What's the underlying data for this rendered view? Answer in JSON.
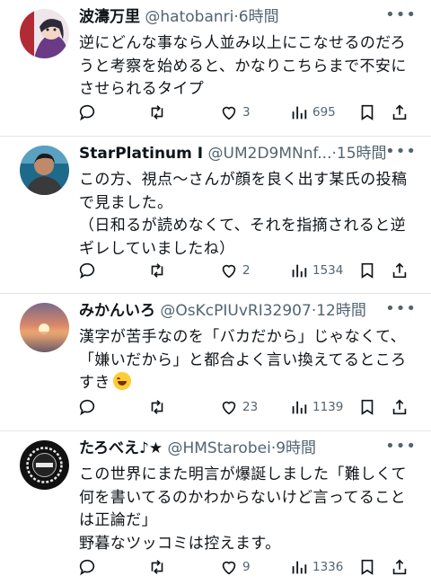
{
  "posts": [
    {
      "name": "波濤万里",
      "handle": "@hatobanri",
      "time": "·6時間",
      "lines": [
        "逆にどんな事なら人並み以上にこなせるのだろ",
        "うと考察を始めると、かなりこちらまで不安に",
        "させられるタイプ"
      ],
      "likes": "3",
      "views": "695"
    },
    {
      "name": "StarPlatinum I",
      "handle": "@UM2D9MNnf...",
      "time": "·15時間",
      "lines": [
        "この方、視点〜さんが顔を良く出す某氏の投稿",
        "で見ました。",
        "（日和るが読めなくて、それを指摘されると逆",
        "ギレしていましたね）"
      ],
      "likes": "2",
      "views": "1534"
    },
    {
      "name": "みかんいろ",
      "handle": "@OsKcPIUvRI32907",
      "time": "·12時間",
      "lines": [
        "漢字が苦手なのを「バカだから」じゃなくて、",
        "「嫌いだから」と都合よく言い換えてるところ",
        "すき"
      ],
      "likes": "23",
      "views": "1139"
    },
    {
      "name": "たろべえ♪★",
      "handle": "@HMStarobei",
      "time": "·9時間",
      "lines": [
        "この世界にまた明言が爆誕しました「難しくて",
        "何を書いてるのかわからないけど言ってること",
        "は正論だ」",
        "野暮なツッコミは控えます。"
      ],
      "likes": "9",
      "views": "1336"
    }
  ],
  "icons": [
    "reply-icon",
    "retweet-icon",
    "like-icon",
    "views-icon",
    "bookmark-icon",
    "share-icon",
    "more-icon"
  ],
  "colors": {
    "text": "#0f1419",
    "muted": "#536471",
    "divider": "#e3e6e8"
  }
}
